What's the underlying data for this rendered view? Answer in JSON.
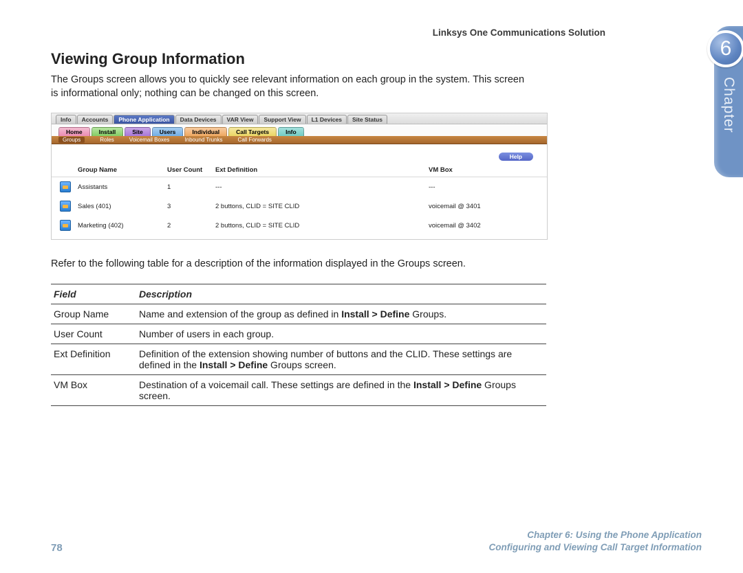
{
  "header": {
    "product": "Linksys One Communications Solution"
  },
  "section": {
    "title": "Viewing Group Information",
    "intro": "The Groups screen allows you to quickly see relevant information on each group in the system. This screen is informational only; nothing can be changed on this screen.",
    "lead_in": "Refer to the following table for a description of the information displayed in the Groups screen."
  },
  "mock": {
    "top_tabs": [
      "Info",
      "Accounts",
      "Phone Application",
      "Data Devices",
      "VAR View",
      "Support View",
      "L1 Devices",
      "Site Status"
    ],
    "top_tabs_active_index": 2,
    "mid_tabs": [
      {
        "label": "Home",
        "cls": "pink"
      },
      {
        "label": "Install",
        "cls": "green"
      },
      {
        "label": "Site",
        "cls": "purple"
      },
      {
        "label": "Users",
        "cls": "blue"
      },
      {
        "label": "Individual",
        "cls": "orange"
      },
      {
        "label": "Call Targets",
        "cls": "yellow"
      },
      {
        "label": "Info",
        "cls": "teal"
      }
    ],
    "sub_nav": [
      "Groups",
      "Roles",
      "Voicemail Boxes",
      "Inbound Trunks",
      "Call Forwards"
    ],
    "sub_nav_sel_index": 0,
    "help_label": "Help",
    "grid_headers": {
      "name": "Group Name",
      "count": "User Count",
      "ext": "Ext Definition",
      "vm": "VM Box"
    },
    "grid_rows": [
      {
        "name": "Assistants",
        "count": "1",
        "ext": "---",
        "vm": "---"
      },
      {
        "name": "Sales (401)",
        "count": "3",
        "ext": "2 buttons, CLID = SITE CLID",
        "vm": "voicemail @ 3401"
      },
      {
        "name": "Marketing (402)",
        "count": "2",
        "ext": "2 buttons, CLID = SITE CLID",
        "vm": "voicemail @ 3402"
      }
    ]
  },
  "table": {
    "head_field": "Field",
    "head_desc": "Description",
    "rows": [
      {
        "field": "Group Name",
        "desc_pre": "Name and extension of the group as defined in ",
        "bold": "Install > Define",
        "desc_post": " Groups."
      },
      {
        "field": "User Count",
        "desc_pre": "Number of users in each group.",
        "bold": "",
        "desc_post": ""
      },
      {
        "field": "Ext Definition",
        "desc_pre": "Definition of the extension showing number of buttons and the CLID. These settings are defined in the ",
        "bold": "Install > Define",
        "desc_post": " Groups screen."
      },
      {
        "field": "VM Box",
        "desc_pre": "Destination of a voicemail call. These settings are defined in the ",
        "bold": "Install > Define",
        "desc_post": " Groups screen."
      }
    ]
  },
  "footer": {
    "page": "78",
    "line1": "Chapter 6: Using the Phone Application",
    "line2": "Configuring and Viewing Call Target Information"
  },
  "thumb": {
    "number": "6",
    "label": "Chapter"
  }
}
